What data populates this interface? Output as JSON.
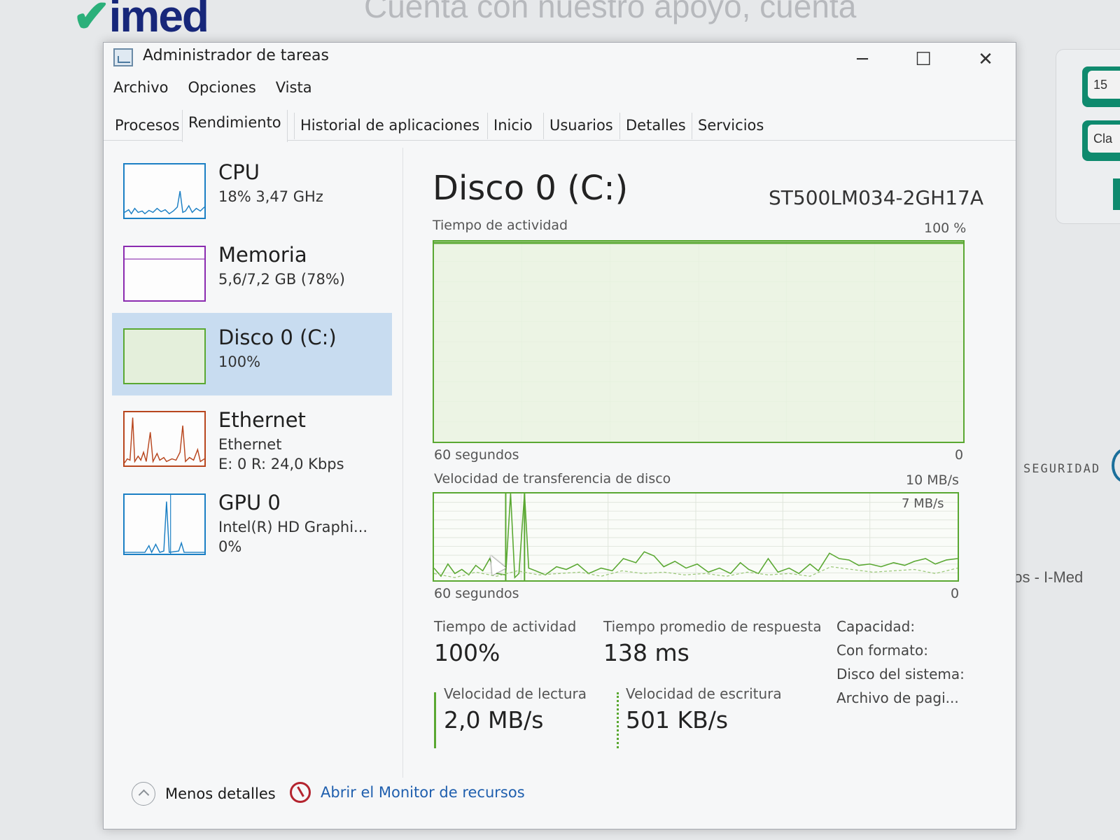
{
  "background": {
    "logo": "imed",
    "headline": "Cuenta con nuestro apoyo, cuenta",
    "button1": "15",
    "button2": "Cla",
    "seguridad": "SEGURIDAD",
    "snippet": "dos - I-Med"
  },
  "window": {
    "title": "Administrador de tareas",
    "controls": {
      "minimize": "─",
      "maximize": "☐",
      "close": "✕"
    }
  },
  "menu": [
    "Archivo",
    "Opciones",
    "Vista"
  ],
  "tabs": [
    "Procesos",
    "Rendimiento",
    "Historial de aplicaciones",
    "Inicio",
    "Usuarios",
    "Detalles",
    "Servicios"
  ],
  "active_tab": "Rendimiento",
  "resources": [
    {
      "name": "CPU",
      "line1": "18% 3,47 GHz",
      "line2": "",
      "color": "#1b7fc4",
      "selected": false
    },
    {
      "name": "Memoria",
      "line1": "5,6/7,2 GB (78%)",
      "line2": "",
      "color": "#8b2bb0",
      "selected": false
    },
    {
      "name": "Disco 0 (C:)",
      "line1": "100%",
      "line2": "",
      "color": "#5aa832",
      "selected": true
    },
    {
      "name": "Ethernet",
      "line1": "Ethernet",
      "line2": "E: 0 R: 24,0 Kbps",
      "color": "#b8461e",
      "selected": false
    },
    {
      "name": "GPU 0",
      "line1": "Intel(R) HD Graphi...",
      "line2": "0%",
      "color": "#1b7fc4",
      "selected": false
    }
  ],
  "detail": {
    "title": "Disco 0 (C:)",
    "model": "ST500LM034-2GH17A",
    "chart1": {
      "label": "Tiempo de actividad",
      "max_label": "100 %",
      "time_label": "60 segundos",
      "zero_label": "0",
      "activity_percent": 100
    },
    "chart2": {
      "label": "Velocidad de transferencia de disco",
      "max_label": "10 MB/s",
      "inner_label": "7 MB/s",
      "time_label": "60 segundos",
      "zero_label": "0"
    },
    "stats": {
      "active_time_label": "Tiempo de actividad",
      "active_time_value": "100%",
      "response_label": "Tiempo promedio de respuesta",
      "response_value": "138 ms",
      "read_label": "Velocidad de lectura",
      "read_value": "2,0 MB/s",
      "write_label": "Velocidad de escritura",
      "write_value": "501 KB/s"
    },
    "info": [
      "Capacidad:",
      "Con formato:",
      "Disco del sistema:",
      "Archivo de pagi..."
    ]
  },
  "footer": {
    "less_details": "Menos detalles",
    "resource_monitor": "Abrir el Monitor de recursos"
  }
}
